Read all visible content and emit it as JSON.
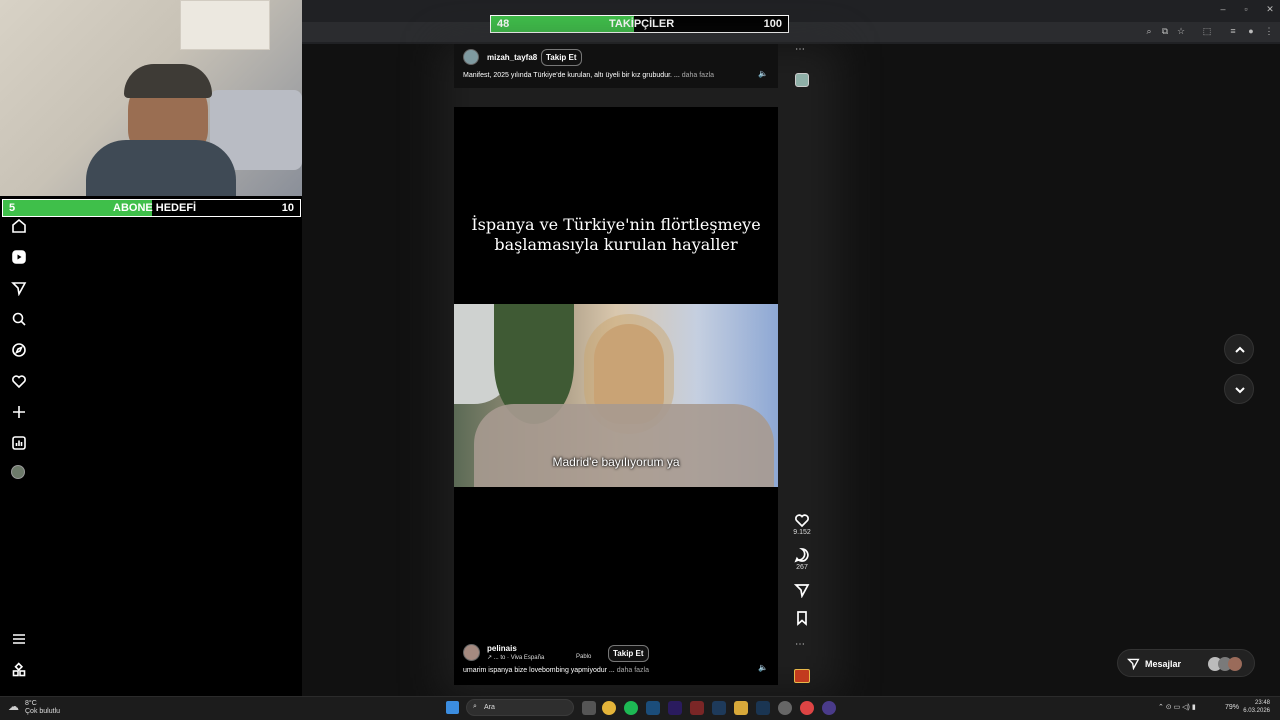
{
  "overlay": {
    "followers_goal": {
      "current": "48",
      "label": "TAKİPÇİLER",
      "target": "100",
      "progress": 0.48
    },
    "subscriber_goal": {
      "current": "5",
      "label": "ABONE HEDEFİ",
      "target": "10",
      "progress": 0.5
    }
  },
  "sidebar": {
    "items": [
      "home-icon",
      "reels-icon",
      "send-icon",
      "search-icon",
      "explore-icon",
      "heart-icon",
      "create-icon",
      "stats-icon",
      "profile-avatar"
    ],
    "bottom": [
      "menu-icon",
      "apps-icon"
    ]
  },
  "previous_post": {
    "username": "mizah_tayfa8",
    "follow_label": "Takip Et",
    "caption": "Manifest, 2025 yılında Türkiye'de kurulan, altı üyeli bir kız grubudur. ...",
    "more_label": "daha fazla",
    "more_icon": "more-icon"
  },
  "reel": {
    "headline_line1": "İspanya ve Türkiye'nin flörtleşmeye",
    "headline_line2": "başlamasıyla kurulan hayaller",
    "subtitle": "Madrid'e bayılıyorum ya",
    "username": "pelinais",
    "audio": "↗ ... to · Viva España",
    "audio_extra": "Pablo",
    "follow_label": "Takip Et",
    "caption": "umarim ispanya bize lovebombing yapmiyodur ...",
    "more_label": "daha fazla"
  },
  "actions": {
    "likes": "9.152",
    "comments": "267"
  },
  "messages": {
    "label": "Mesajlar"
  },
  "taskbar": {
    "weather_temp": "8°C",
    "weather_desc": "Çok bulutlu",
    "search_placeholder": "Ara",
    "battery": "79%",
    "time": "23:48",
    "date": "6.03.2026"
  },
  "colors": {
    "goal_fill": "#3fbf4a",
    "background": "#000000"
  }
}
